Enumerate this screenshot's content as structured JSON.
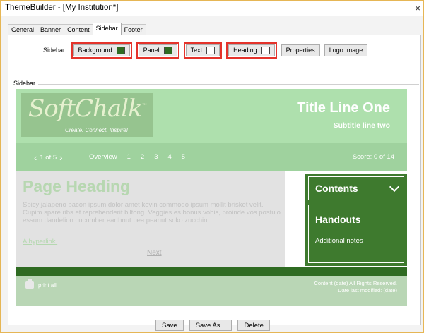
{
  "window": {
    "title": "ThemeBuilder - [My Institution*]",
    "close_glyph": "×"
  },
  "tabs": [
    {
      "label": "General"
    },
    {
      "label": "Banner"
    },
    {
      "label": "Content"
    },
    {
      "label": "Sidebar",
      "active": true
    },
    {
      "label": "Footer"
    }
  ],
  "sidebar_controls": {
    "label": "Sidebar:",
    "background_label": "Background",
    "background_color": "#2f6b22",
    "panel_label": "Panel",
    "panel_color": "#2f6b22",
    "text_label": "Text",
    "text_color": "#ffffff",
    "heading_label": "Heading",
    "heading_color": "#ffffff",
    "properties_label": "Properties",
    "logo_image_label": "Logo Image"
  },
  "fieldset_label": "Sidebar",
  "preview": {
    "logo_text": "SoftChalk",
    "logo_tm": "™",
    "logo_tagline": "Create. Connect. Inspire!",
    "title": "Title Line One",
    "subtitle": "Subtitle line two",
    "nav": {
      "prev_glyph": "‹",
      "page_counter": "1 of 5",
      "next_glyph": "›",
      "overview": "Overview",
      "pages": [
        "1",
        "2",
        "3",
        "4",
        "5"
      ],
      "score": "Score: 0 of 14"
    },
    "page_heading": "Page Heading",
    "body_text": "Spicy jalapeno bacon ipsum dolor amet kevin commodo ipsum mollit brisket velit. Cupim spare ribs et reprehenderit biltong. Veggies es bonus vobis, proinde vos postulo essum dandelion cucumber earthnut pea peanut soko zucchini.",
    "hyperlink": "A hyperlink.",
    "next": "Next",
    "contents_label": "Contents",
    "handouts_label": "Handouts",
    "handouts_notes": "Additional notes",
    "print_all": "print all",
    "copyright_line1": "Content (date) All Rights Reserved.",
    "copyright_line2": "Date last modified: (date)"
  },
  "bottom_buttons": {
    "save": "Save",
    "save_as": "Save As...",
    "delete": "Delete"
  }
}
